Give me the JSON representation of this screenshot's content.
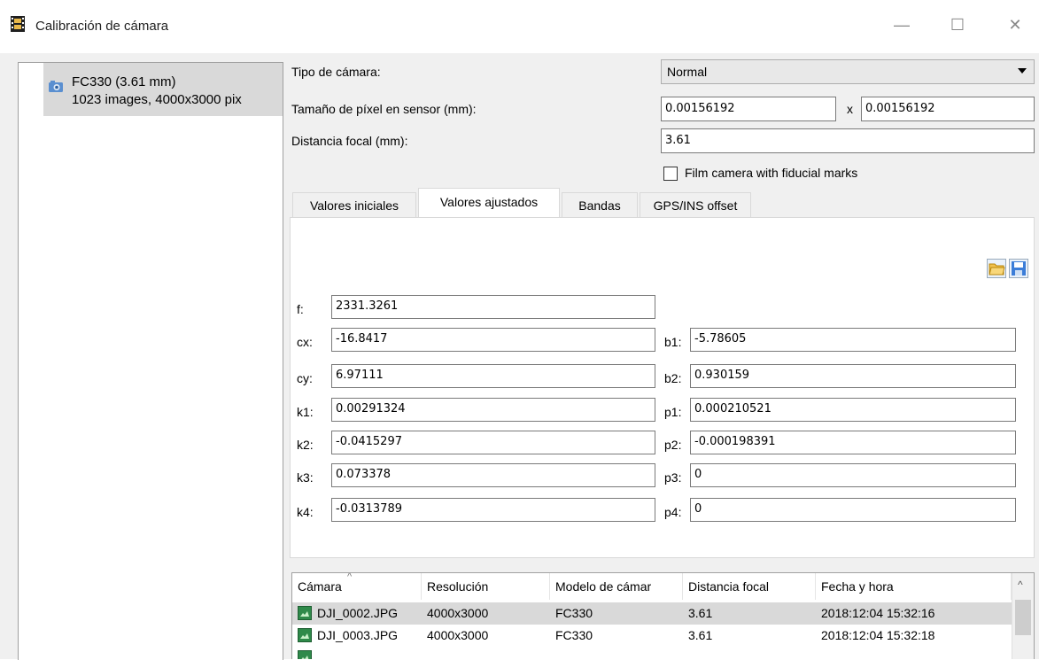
{
  "window": {
    "title": "Calibración de cámara",
    "controls": {
      "minimize": "—",
      "maximize": "☐",
      "close": "✕"
    }
  },
  "cameras": [
    {
      "name": "FC330 (3.61 mm)",
      "details": "1023 images, 4000x3000 pix",
      "icon": "camera-icon"
    }
  ],
  "settings": {
    "camera_type_label": "Tipo de cámara:",
    "camera_type_value": "Normal",
    "pixel_size_label": "Tamaño de píxel en sensor (mm):",
    "pixel_size_x": "0.00156192",
    "pixel_size_sep": "x",
    "pixel_size_y": "0.00156192",
    "focal_label": "Distancia focal (mm):",
    "focal_value": "3.61",
    "fiducial_label": "Film camera with fiducial marks",
    "fiducial_checked": false
  },
  "tabs": [
    {
      "label": "Valores iniciales",
      "active": false
    },
    {
      "label": "Valores ajustados",
      "active": true
    },
    {
      "label": "Bandas",
      "active": false
    },
    {
      "label": "GPS/INS offset",
      "active": false
    }
  ],
  "toolbar": {
    "open_icon": "folder-open-icon",
    "save_icon": "save-icon"
  },
  "params": {
    "f": {
      "label": "f:",
      "value": "2331.3261"
    },
    "left": [
      {
        "label": "cx:",
        "value": "-16.8417"
      },
      {
        "label": "cy:",
        "value": "6.97111"
      },
      {
        "label": "k1:",
        "value": "0.00291324"
      },
      {
        "label": "k2:",
        "value": "-0.0415297"
      },
      {
        "label": "k3:",
        "value": "0.073378"
      },
      {
        "label": "k4:",
        "value": "-0.0313789"
      }
    ],
    "right": [
      {
        "label": "b1:",
        "value": "-5.78605"
      },
      {
        "label": "b2:",
        "value": "0.930159"
      },
      {
        "label": "p1:",
        "value": "0.000210521"
      },
      {
        "label": "p2:",
        "value": "-0.000198391"
      },
      {
        "label": "p3:",
        "value": "0"
      },
      {
        "label": "p4:",
        "value": "0"
      }
    ]
  },
  "table": {
    "columns": [
      "Cámara",
      "Resolución",
      "Modelo de cámar",
      "Distancia focal",
      "Fecha y hora"
    ],
    "rows": [
      {
        "name": "DJI_0002.JPG",
        "res": "4000x3000",
        "model": "FC330",
        "focal": "3.61",
        "date": "2018:12:04 15:32:16",
        "selected": true
      },
      {
        "name": "DJI_0003.JPG",
        "res": "4000x3000",
        "model": "FC330",
        "focal": "3.61",
        "date": "2018:12:04 15:32:18",
        "selected": false
      }
    ]
  },
  "colors": {
    "selection": "#d9d9d9",
    "window_bg": "#f0f0f0",
    "icon_blue": "#3b7dd8"
  }
}
